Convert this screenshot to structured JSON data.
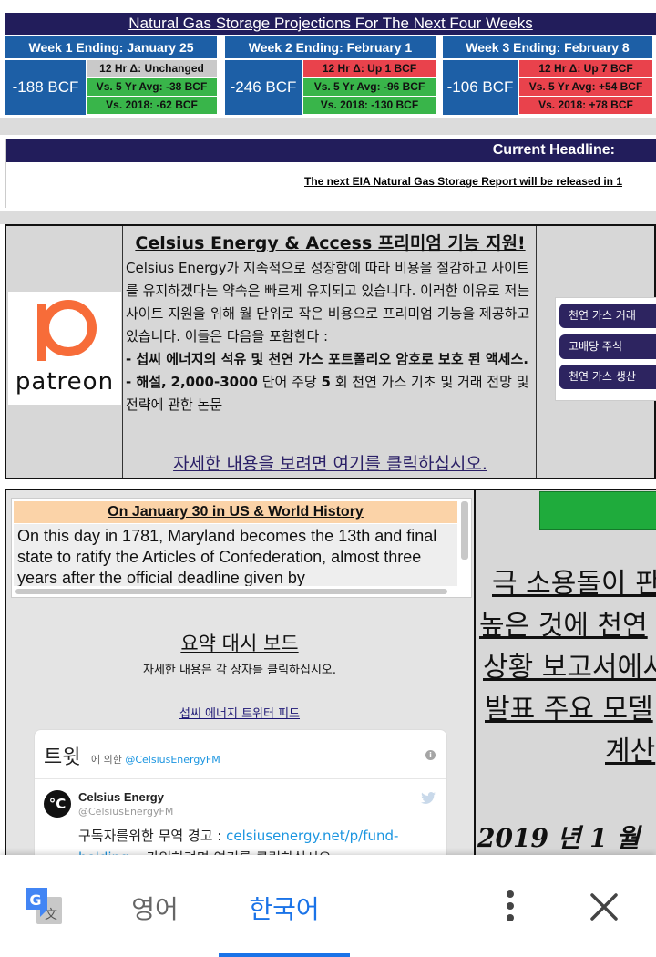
{
  "storage": {
    "title": "Natural Gas Storage Projections For The Next Four Weeks",
    "weeks": [
      {
        "header": "Week 1 Ending: January 25",
        "value": "-188 BCF",
        "rows": [
          "12 Hr Δ: Unchanged",
          "Vs. 5 Yr Avg: -38 BCF",
          "Vs. 2018: -62 BCF"
        ],
        "row_colors": [
          "#c9c9c9",
          "#39b54a",
          "#39b54a"
        ]
      },
      {
        "header": "Week 2 Ending: February 1",
        "value": "-246 BCF",
        "rows": [
          "12 Hr Δ: Up 1 BCF",
          "Vs. 5 Yr Avg: -96 BCF",
          "Vs. 2018: -130 BCF"
        ],
        "row_colors": [
          "#e9424c",
          "#39b54a",
          "#39b54a"
        ]
      },
      {
        "header": "Week 3 Ending: February 8",
        "value": "-106 BCF",
        "rows": [
          "12 Hr Δ: Up 7 BCF",
          "Vs. 5 Yr Avg: +54 BCF",
          "Vs. 2018: +78 BCF"
        ],
        "row_colors": [
          "#e9424c",
          "#e9424c",
          "#e9424c"
        ]
      }
    ]
  },
  "headline": {
    "label": "Current Headline:",
    "text": "The next EIA Natural Gas Storage Report will be released in 1"
  },
  "promo": {
    "logo_word": "patreon",
    "title": "Celsius Energy & Access 프리미엄 기능 지원!",
    "body_plain": "Celsius Energy가 지속적으로 성장함에 따라 비용을 절감하고 사이트를 유지하겠다는 약속은 빠르게 유지되고 있습니다. 이러한 이유로 저는 사이트 지원을 위해 월 단위로 작은 비용으로 프리미엄 기능을 제공하고 있습니다. 이들은 다음을 포함한다 :",
    "bullet1": "- 섭씨 에너지의 석유 및 천연 가스 포트폴리오 암호로 보호 된 액세스.",
    "bullet2_pre": "- 해설,",
    "bullet2_bold": "2,000-3000",
    "bullet2_mid": "단어 주당",
    "bullet2_num": "5",
    "bullet2_post": "회 천연 가스 기초 및 거래 전망 및 전략에 관한 논문",
    "link": "자세한 내용을 보려면 여기를 클릭하십시오.",
    "side_buttons": [
      "천연 가스 거래",
      "고배당 주식",
      "천연 가스 생산"
    ]
  },
  "history": {
    "title": "On January 30 in US & World History",
    "body": "On this day in 1781, Maryland becomes the 13th and final state to ratify the Articles of Confederation, almost three years after the official deadline given by"
  },
  "dashboard": {
    "title": "요약 대시 보드",
    "subtitle": "자세한 내용은 각 상자를 클릭하십시오.",
    "twitter_link": "섭씨 에너지 트위터 피드"
  },
  "tweet": {
    "header_word": "트윗",
    "header_by": "에 의한",
    "header_handle": "@CelsiusEnergyFM",
    "avatar_text": "°C",
    "author_name": "Celsius Energy",
    "author_handle": "@CelsiusEnergyFM",
    "text_pre": "구독자를위한 무역 경고 :",
    "text_link": "celsiusenergy.net/p/fund-holding...",
    "text_post": "가입하려면 여기를 클릭하십시오 :"
  },
  "right_column": {
    "heading_lines": [
      "극 소용돌이 판",
      "높은 것에 천연",
      "상황 보고서에서",
      "발표 주요 모델",
      "계산"
    ],
    "date": "2019 년 1 월"
  },
  "translate_bar": {
    "lang_source": "영어",
    "lang_target": "한국어"
  },
  "colors": {
    "navy": "#221d5b",
    "week_blue": "#1d5fa6",
    "green": "#39b54a",
    "red": "#e9424c",
    "translate_blue": "#1a73e8"
  }
}
